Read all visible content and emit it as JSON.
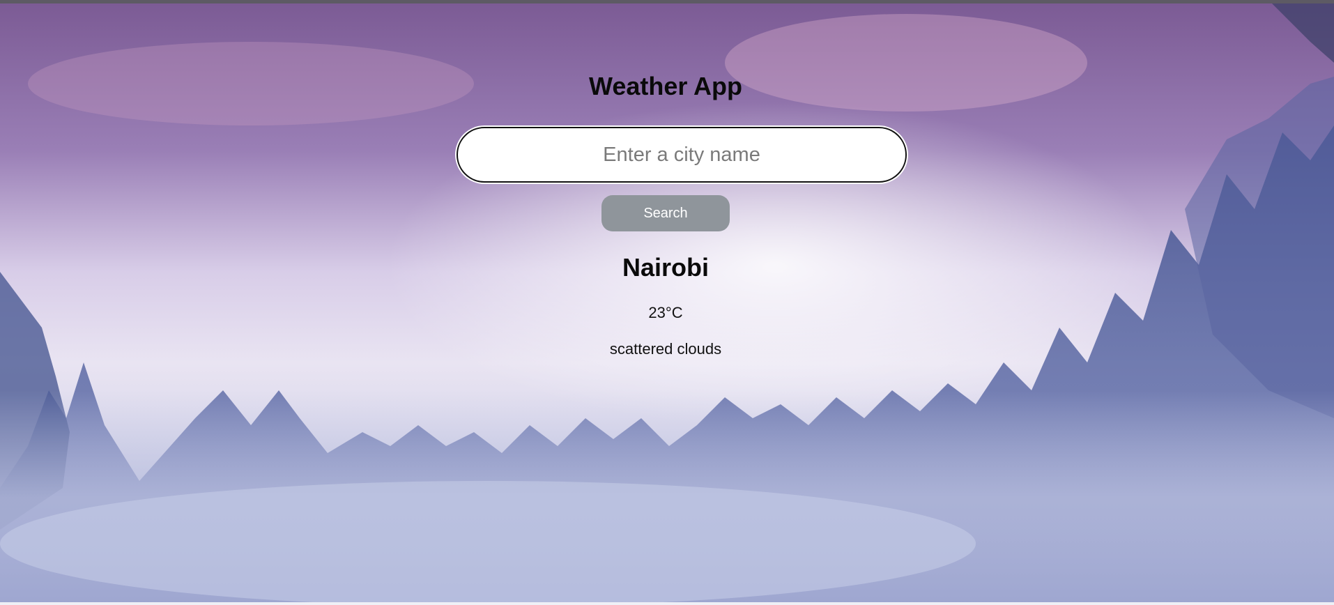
{
  "app": {
    "title": "Weather App"
  },
  "search": {
    "placeholder": "Enter a city name",
    "value": "",
    "button_label": "Search"
  },
  "weather": {
    "city": "Nairobi",
    "temperature": "23°C",
    "description": "scattered clouds"
  },
  "background": {
    "scene": "snowy-forest-purple-sky"
  }
}
